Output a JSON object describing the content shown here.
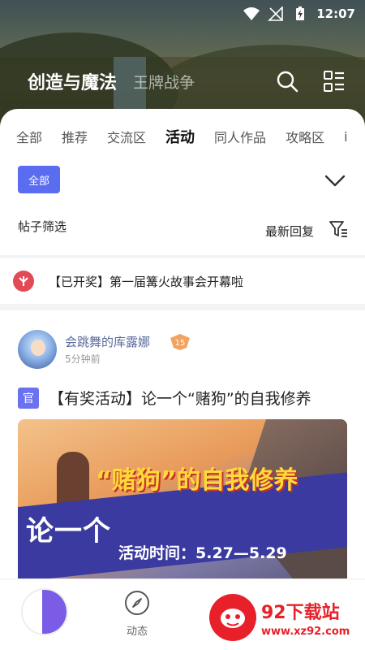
{
  "status_bar": {
    "time": "12:07"
  },
  "header": {
    "title": "创造与魔法",
    "subtitle": "王牌战争"
  },
  "tabs": [
    "全部",
    "推荐",
    "交流区",
    "活动",
    "同人作品",
    "攻略区",
    "i"
  ],
  "active_tab_index": 3,
  "chip": {
    "label": "全部"
  },
  "filter": {
    "label": "帖子筛选",
    "sort_label": "最新回复"
  },
  "notice": {
    "text": "【已开奖】第一届篝火故事会开幕啦"
  },
  "post": {
    "username": "会跳舞的库露娜",
    "level": "15",
    "time": "5分钟前",
    "badge": "官",
    "title": "【有奖活动】论一个“赌狗”的自我修养",
    "image_text_left": "论一个",
    "image_text_main": "“赌狗”的自我修养",
    "image_text_date": "活动时间：5.27—5.29"
  },
  "bottom_nav": {
    "dynamic_label": "动态"
  },
  "watermark": {
    "title": "92下载站",
    "url": "www.xz92.com"
  },
  "colors": {
    "accent": "#5a6cf0",
    "notice_icon": "#e24a55",
    "watermark": "#e8202a"
  }
}
